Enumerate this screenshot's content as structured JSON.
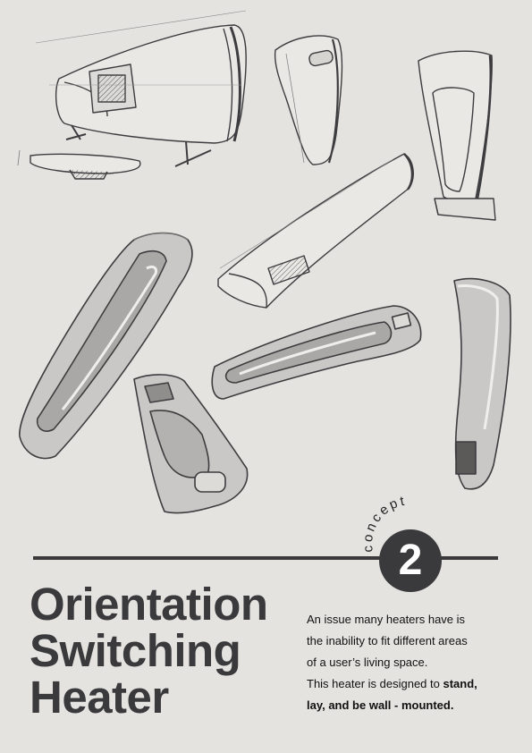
{
  "concept": {
    "label": "concept",
    "number": "2"
  },
  "title": {
    "line1": "Orientation",
    "line2": "Switching",
    "line3": "Heater"
  },
  "description": {
    "line1": "An issue many heaters have is",
    "line2": "the inability to fit different areas",
    "line3": "of a user’s living space.",
    "line4_plain": "This heater is designed to ",
    "line4_bold": "stand,",
    "line5_bold": "lay, and be wall - mounted."
  },
  "colors": {
    "background": "#e4e3e0",
    "ink": "#3a3a3c"
  }
}
